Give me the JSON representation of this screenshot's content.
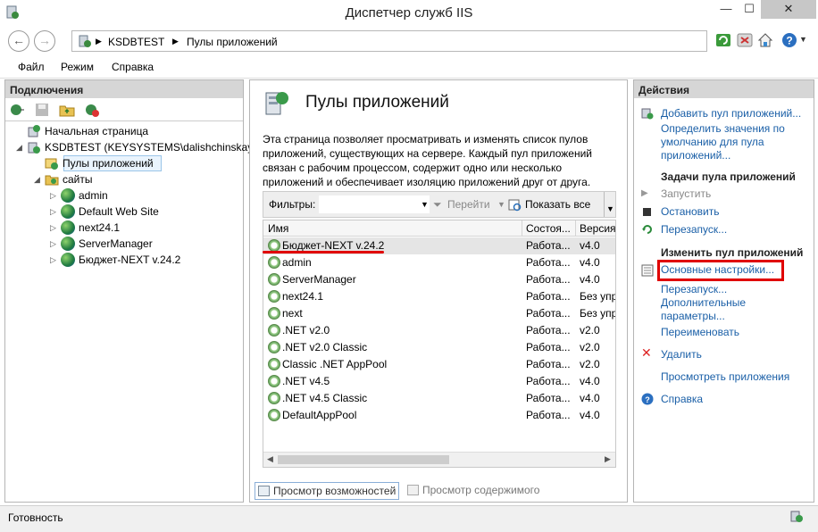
{
  "window": {
    "title": "Диспетчер служб IIS",
    "min": "—",
    "max": "☐",
    "close": "✕"
  },
  "nav": {
    "back": "←",
    "forward": "→",
    "breadcrumb": [
      "KSDBTEST",
      "Пулы приложений"
    ],
    "sep": "▶"
  },
  "menu": [
    "Файл",
    "Режим",
    "Справка"
  ],
  "connections": {
    "header": "Подключения",
    "tree": [
      {
        "label": "Начальная страница",
        "icon": "home-icon"
      },
      {
        "label": "KSDBTEST (KEYSYSTEMS\\dalishchinskaya)",
        "icon": "server-icon"
      },
      {
        "label": "Пулы приложений",
        "icon": "app-pool-icon"
      },
      {
        "label": "сайты",
        "icon": "sites-folder-icon"
      },
      {
        "label": "admin",
        "icon": "globe-icon"
      },
      {
        "label": "Default Web Site",
        "icon": "globe-icon"
      },
      {
        "label": "next24.1",
        "icon": "globe-icon"
      },
      {
        "label": "ServerManager",
        "icon": "globe-icon"
      },
      {
        "label": "Бюджет-NEXT v.24.2",
        "icon": "globe-icon"
      }
    ]
  },
  "center": {
    "title": "Пулы приложений",
    "description": "Эта страница позволяет просматривать и изменять список пулов приложений, существующих на сервере. Каждый пул приложений связан с рабочим процессом, содержит одно или несколько приложений и обеспечивает изоляцию приложений друг от друга.",
    "filter_label": "Фильтры:",
    "go_label": "Перейти",
    "show_all_label": "Показать все",
    "columns": [
      "Имя",
      "Состоя...",
      "Версия"
    ],
    "rows": [
      {
        "name": "Бюджет-NEXT v.24.2",
        "status": "Работа...",
        "version": "v4.0"
      },
      {
        "name": "admin",
        "status": "Работа...",
        "version": "v4.0"
      },
      {
        "name": "ServerManager",
        "status": "Работа...",
        "version": "v4.0"
      },
      {
        "name": "next24.1",
        "status": "Работа...",
        "version": "Без упр"
      },
      {
        "name": "next",
        "status": "Работа...",
        "version": "Без упр"
      },
      {
        "name": ".NET v2.0",
        "status": "Работа...",
        "version": "v2.0"
      },
      {
        "name": ".NET v2.0 Classic",
        "status": "Работа...",
        "version": "v2.0"
      },
      {
        "name": "Classic .NET AppPool",
        "status": "Работа...",
        "version": "v2.0"
      },
      {
        "name": ".NET v4.5",
        "status": "Работа...",
        "version": "v4.0"
      },
      {
        "name": ".NET v4.5 Classic",
        "status": "Работа...",
        "version": "v4.0"
      },
      {
        "name": "DefaultAppPool",
        "status": "Работа...",
        "version": "v4.0"
      }
    ],
    "tabs": [
      "Просмотр возможностей",
      "Просмотр содержимого"
    ]
  },
  "actions": {
    "header": "Действия",
    "add_pool": "Добавить пул приложений...",
    "set_defaults": "Определить значения по умолчанию для пула приложений...",
    "tasks_header": "Задачи пула приложений",
    "start": "Запустить",
    "stop": "Остановить",
    "recycle": "Перезапуск...",
    "edit_header": "Изменить пул приложений",
    "basic_settings": "Основные настройки...",
    "recycle2": "Перезапуск...",
    "advanced": "Дополнительные параметры...",
    "rename": "Переименовать",
    "delete": "Удалить",
    "view_apps": "Просмотреть приложения",
    "help": "Справка"
  },
  "status": {
    "text": "Готовность"
  },
  "colors": {
    "highlight": "#e00000",
    "link": "#1a5fa7"
  }
}
